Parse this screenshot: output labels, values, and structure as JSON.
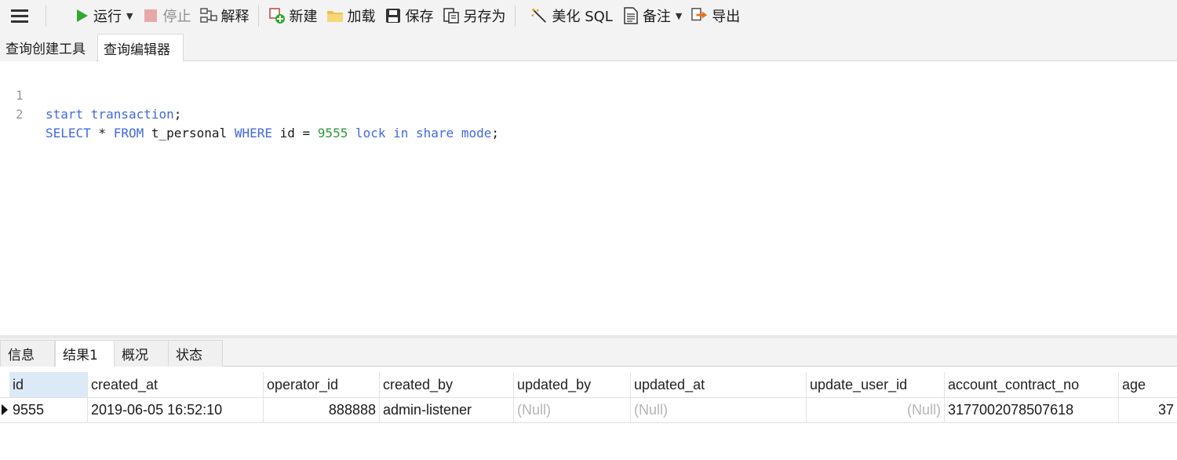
{
  "toolbar": {
    "run": "运行",
    "stop": "停止",
    "explain": "解释",
    "new": "新建",
    "load": "加载",
    "save": "保存",
    "save_as": "另存为",
    "beautify": "美化 SQL",
    "notes": "备注",
    "export": "导出"
  },
  "editor_tabs": {
    "query_builder": "查询创建工具",
    "query_editor": "查询编辑器"
  },
  "code": {
    "lines": [
      {
        "n": "1",
        "t1": "start transaction",
        "t2": ";"
      },
      {
        "n": "2",
        "kw1": "SELECT",
        "star": " * ",
        "kw2": "FROM",
        "tbl": " t_personal ",
        "kw3": "WHERE",
        "cond": " id = ",
        "num": "9555",
        "kw4": " lock in share mode",
        "end": ";"
      }
    ]
  },
  "result_tabs": {
    "info": "信息",
    "result1": "结果1",
    "profile": "概况",
    "status": "状态"
  },
  "grid": {
    "columns": [
      "id",
      "created_at",
      "operator_id",
      "created_by",
      "updated_by",
      "updated_at",
      "update_user_id",
      "account_contract_no",
      "age"
    ],
    "row": [
      "9555",
      "2019-06-05 16:52:10",
      "888888",
      "admin-listener",
      "(Null)",
      "(Null)",
      "(Null)",
      "3177002078507618",
      "37"
    ]
  },
  "colors": {
    "keyword": "#4169e1",
    "number": "#2e9b3a",
    "run_icon": "#2faa2f",
    "selection": "#dce9f7"
  },
  "icons": [
    "menu-icon",
    "run-icon",
    "stop-icon",
    "explain-icon",
    "new-icon",
    "load-icon",
    "save-icon",
    "save-as-icon",
    "beautify-icon",
    "notes-icon",
    "export-icon"
  ]
}
